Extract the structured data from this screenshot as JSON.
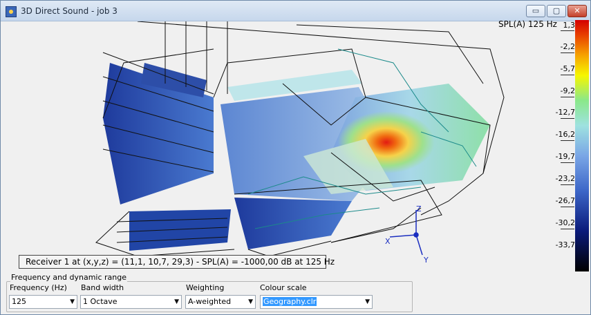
{
  "window": {
    "title": "3D Direct Sound - job 3",
    "buttons": {
      "minimize": "▭",
      "maximize": "▢",
      "close": "✕"
    }
  },
  "view": {
    "spl_title": "SPL(A) 125 Hz",
    "scale": [
      "1,3",
      "-2,2",
      "-5,7",
      "-9,2",
      "-12,7",
      "-16,2",
      "-19,7",
      "-23,2",
      "-26,7",
      "-30,2",
      "-33,7"
    ],
    "axes": {
      "x": "X",
      "y": "Y",
      "z": "Z"
    },
    "status": "Receiver 1 at (x,y,z) = (11,1, 10,7, 29,3) - SPL(A) = -1000,00 dB at 125 Hz"
  },
  "controls": {
    "group_title": "Frequency and dynamic range",
    "frequency": {
      "label": "Frequency (Hz)",
      "value": "125"
    },
    "bandwidth": {
      "label": "Band width",
      "value": "1 Octave"
    },
    "weighting": {
      "label": "Weighting",
      "value": "A-weighted"
    },
    "colour_scale": {
      "label": "Colour scale",
      "value": "Geography.clr"
    }
  }
}
